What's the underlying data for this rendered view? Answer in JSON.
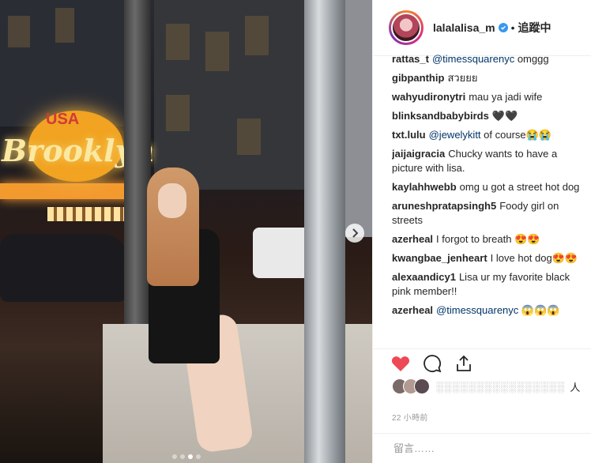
{
  "photo": {
    "dots_total": 4,
    "active_dot": 2,
    "neon_sign": "Brooklyn",
    "neon_sign_top": "USA",
    "next_icon": "chevron-right-icon"
  },
  "header": {
    "username": "lalalalisa_m",
    "verified": true,
    "separator": "•",
    "follow_status": "追蹤中",
    "avatar_icon": "avatar"
  },
  "comments": [
    {
      "user": "rattas_t",
      "text": "",
      "mention": "@timessquarenyc",
      "after": " omggg"
    },
    {
      "user": "gibpanthip",
      "text": "สวยยย",
      "mention": "",
      "after": ""
    },
    {
      "user": "wahyudironytri",
      "text": "mau ya jadi wife",
      "mention": "",
      "after": ""
    },
    {
      "user": "blinksandbabybirds",
      "text": "🖤🖤",
      "mention": "",
      "after": ""
    },
    {
      "user": "txt.lulu",
      "text": "",
      "mention": "@jewelykitt",
      "after": " of course😭😭"
    },
    {
      "user": "jaijaigracia",
      "text": "Chucky wants to have a picture with lisa.",
      "mention": "",
      "after": ""
    },
    {
      "user": "kaylahhwebb",
      "text": "omg u got a street hot dog",
      "mention": "",
      "after": ""
    },
    {
      "user": "aruneshpratapsingh5",
      "text": "Foody girl on streets",
      "mention": "",
      "after": ""
    },
    {
      "user": "azerheal",
      "text": "I forgot to breath 😍😍",
      "mention": "",
      "after": ""
    },
    {
      "user": "kwangbae_jenheart",
      "text": "I love hot dog😍😍",
      "mention": "",
      "after": ""
    },
    {
      "user": "alexaandicy1",
      "text": "Lisa ur my favorite black pink member!!",
      "mention": "",
      "after": ""
    },
    {
      "user": "azerheal",
      "text": "",
      "mention": "@timessquarenyc",
      "after": " 😱😱😱"
    }
  ],
  "actions": {
    "like_icon": "heart-icon",
    "comment_icon": "comment-icon",
    "share_icon": "share-icon",
    "like_color": "#ed4956"
  },
  "likes": {
    "blurred": "░░░░░░░░░░░░░░░░",
    "suffix": "人"
  },
  "timestamp": "22 小時前",
  "comment_box": {
    "placeholder": "留言……"
  }
}
